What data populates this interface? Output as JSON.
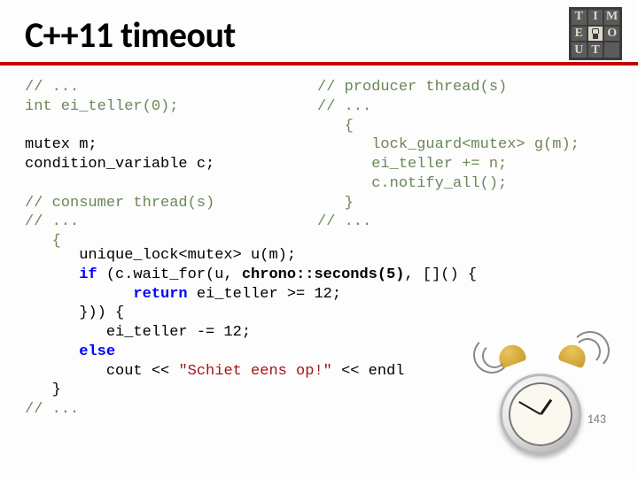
{
  "title": "C++11 timeout",
  "page_number": "143",
  "badge_letters": [
    "T",
    "I",
    "M",
    "E",
    "",
    "O",
    "U",
    "T"
  ],
  "code": {
    "left_1": "// ...\nint ei_teller(0);",
    "left_2": "mutex m;\ncondition_variable c;",
    "left_3_c1": "// consumer thread(s)\n// ...\n   {",
    "right": "// producer thread(s)\n// ...\n   {\n      lock_guard<mutex> g(m);\n      ei_teller += n;\n      c.notify_all();\n   }\n// ...",
    "body_l1": "      unique_lock<mutex> u(m);",
    "body_l2a": "      ",
    "body_l2_if": "if",
    "body_l2b": " (c.wait_for(u, ",
    "body_l2_chrono": "chrono::seconds(5)",
    "body_l2c": ", []() {",
    "body_l3a": "            ",
    "body_l3_ret": "return",
    "body_l3b": " ei_teller >= 12;",
    "body_l4": "      })) {",
    "body_l5": "         ei_teller -= 12;",
    "body_l6a": "      ",
    "body_l6_else": "else",
    "body_l7a": "         cout << ",
    "body_l7_str": "\"Schiet eens op!\"",
    "body_l7b": " << endl",
    "body_l8": "   }",
    "body_l9": "// ..."
  }
}
